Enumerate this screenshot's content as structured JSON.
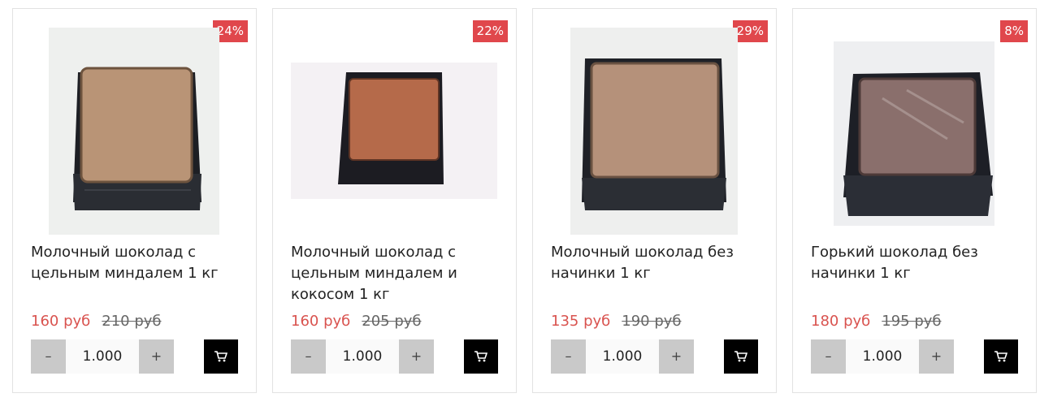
{
  "currency_note": "",
  "products": [
    {
      "badge": "24%",
      "title": "Молочный шоколад с цельным миндалем 1 кг",
      "price_new": "160 руб",
      "price_old": "210 руб",
      "quantity": "1.000",
      "minus_label": "–",
      "plus_label": "+",
      "image_icon": "milk-chocolate-tray-photo",
      "cart_icon": "cart-icon"
    },
    {
      "badge": "22%",
      "title": "Молочный шоколад с цельным миндалем и кокосом 1 кг",
      "price_new": "160 руб",
      "price_old": "205 руб",
      "quantity": "1.000",
      "minus_label": "–",
      "plus_label": "+",
      "image_icon": "chocolate-coconut-tray-photo",
      "cart_icon": "cart-icon"
    },
    {
      "badge": "29%",
      "title": "Молочный шоколад без начинки 1 кг",
      "price_new": "135 руб",
      "price_old": "190 руб",
      "quantity": "1.000",
      "minus_label": "–",
      "plus_label": "+",
      "image_icon": "milk-chocolate-tray-photo",
      "cart_icon": "cart-icon"
    },
    {
      "badge": "8%",
      "title": "Горький шоколад без начинки 1 кг",
      "price_new": "180 руб",
      "price_old": "195 руб",
      "quantity": "1.000",
      "minus_label": "–",
      "plus_label": "+",
      "image_icon": "dark-chocolate-tray-photo",
      "cart_icon": "cart-icon"
    }
  ],
  "colors": {
    "badge": "#e0474c",
    "price_new": "#d9534f",
    "stepper": "#c9c9c9",
    "cart_button": "#000000"
  }
}
